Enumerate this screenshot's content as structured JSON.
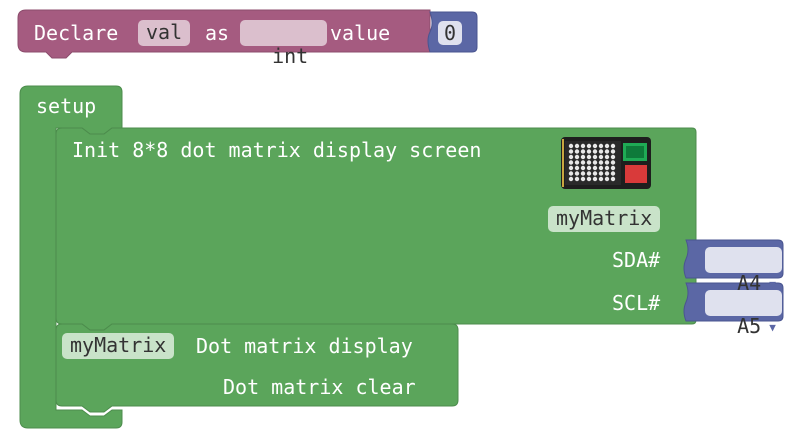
{
  "declare_block": {
    "color": "#a55b80",
    "label_declare": "Declare",
    "var_name": "val",
    "label_as": "as",
    "type_selected": "int",
    "label_value": "value",
    "value_block": {
      "color": "#5b67a5",
      "number": "0"
    }
  },
  "setup_block": {
    "color": "#5ba55b",
    "label": "setup",
    "init_block": {
      "label": "Init 8*8 dot matrix display screen",
      "instance_name": "myMatrix",
      "image_icon": "dot-matrix-module",
      "sda_label": "SDA#",
      "sda_value": "A4",
      "scl_label": "SCL#",
      "scl_value": "A5",
      "pin_block_color": "#5b67a5"
    },
    "display_block": {
      "instance_name": "myMatrix",
      "label_display": "Dot matrix display",
      "label_clear": "Dot matrix clear"
    }
  }
}
